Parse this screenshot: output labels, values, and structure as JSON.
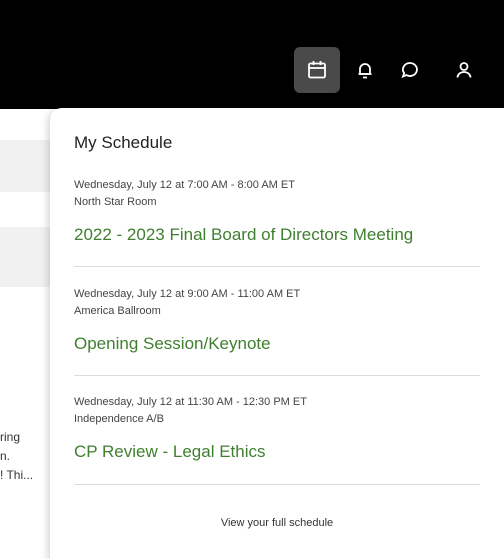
{
  "header": {
    "icons": [
      {
        "name": "calendar-icon",
        "active": true
      },
      {
        "name": "bell-icon",
        "active": false
      },
      {
        "name": "chat-icon",
        "active": false
      },
      {
        "name": "user-icon",
        "active": false
      }
    ]
  },
  "background": {
    "snippet_lines": [
      "ring",
      "n.",
      "! Thi..."
    ]
  },
  "schedule": {
    "title": "My Schedule",
    "events": [
      {
        "datetime": "Wednesday, July 12 at 7:00 AM - 8:00 AM ET",
        "location": "North Star Room",
        "title": "2022 - 2023 Final Board of Directors Meeting"
      },
      {
        "datetime": "Wednesday, July 12 at 9:00 AM - 11:00 AM ET",
        "location": "America Ballroom",
        "title": "Opening Session/Keynote"
      },
      {
        "datetime": "Wednesday, July 12 at 11:30 AM - 12:30 PM ET",
        "location": "Independence A/B",
        "title": "CP Review - Legal Ethics"
      }
    ],
    "view_full_label": "View your full schedule"
  },
  "colors": {
    "header_bg": "#000000",
    "active_icon_bg": "#4a4a4a",
    "event_title": "#3f7f2f"
  }
}
